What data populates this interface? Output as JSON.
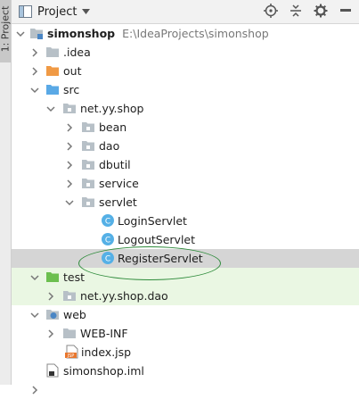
{
  "side_tab": {
    "label": "1: Project"
  },
  "toolbar": {
    "title": "Project",
    "icons": [
      "locate-icon",
      "collapse-all-icon",
      "gear-icon",
      "hide-icon"
    ]
  },
  "tree": {
    "root": {
      "name": "simonshop",
      "path": "E:\\IdeaProjects\\simonshop"
    },
    "idea": ".idea",
    "out": "out",
    "src": "src",
    "pkg": "net.yy.shop",
    "bean": "bean",
    "dao": "dao",
    "dbutil": "dbutil",
    "service": "service",
    "servlet": "servlet",
    "login": "LoginServlet",
    "logout": "LogoutServlet",
    "register": "RegisterServlet",
    "test": "test",
    "testpkg": "net.yy.shop.dao",
    "web": "web",
    "webinf": "WEB-INF",
    "indexjsp": "index.jsp",
    "jsp_badge": "JSP",
    "iml": "simonshop.iml",
    "class_badge": "C"
  },
  "colors": {
    "folder": "#b7c0c7",
    "folder_source": "#5aa9e6",
    "folder_test": "#6cbf4f",
    "folder_out": "#f09a45",
    "class_icon": "#55b0e6",
    "selection": "#d5d5d5",
    "highlight_oval": "#2e8b3b"
  }
}
